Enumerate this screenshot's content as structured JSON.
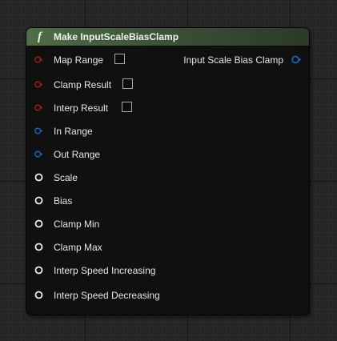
{
  "node": {
    "title": "Make InputScaleBiasClamp",
    "function_icon": "f",
    "colors": {
      "header": "#4f6d47",
      "bool_pin": "#b3201c",
      "struct_pin": "#1c6fd6",
      "float_pin": "#ececec"
    },
    "inputs": [
      {
        "label": "Map Range",
        "pin": "bool",
        "has_checkbox": true,
        "checked": false
      },
      {
        "label": "Clamp Result",
        "pin": "bool",
        "has_checkbox": true,
        "checked": false
      },
      {
        "label": "Interp Result",
        "pin": "bool",
        "has_checkbox": true,
        "checked": false
      },
      {
        "label": "In Range",
        "pin": "struct"
      },
      {
        "label": "Out Range",
        "pin": "struct"
      },
      {
        "label": "Scale",
        "pin": "float"
      },
      {
        "label": "Bias",
        "pin": "float"
      },
      {
        "label": "Clamp Min",
        "pin": "float"
      },
      {
        "label": "Clamp Max",
        "pin": "float"
      },
      {
        "label": "Interp Speed Increasing",
        "pin": "float"
      },
      {
        "label": "Interp Speed Decreasing",
        "pin": "float"
      }
    ],
    "output": {
      "label": "Input Scale Bias Clamp",
      "pin": "struct"
    }
  }
}
